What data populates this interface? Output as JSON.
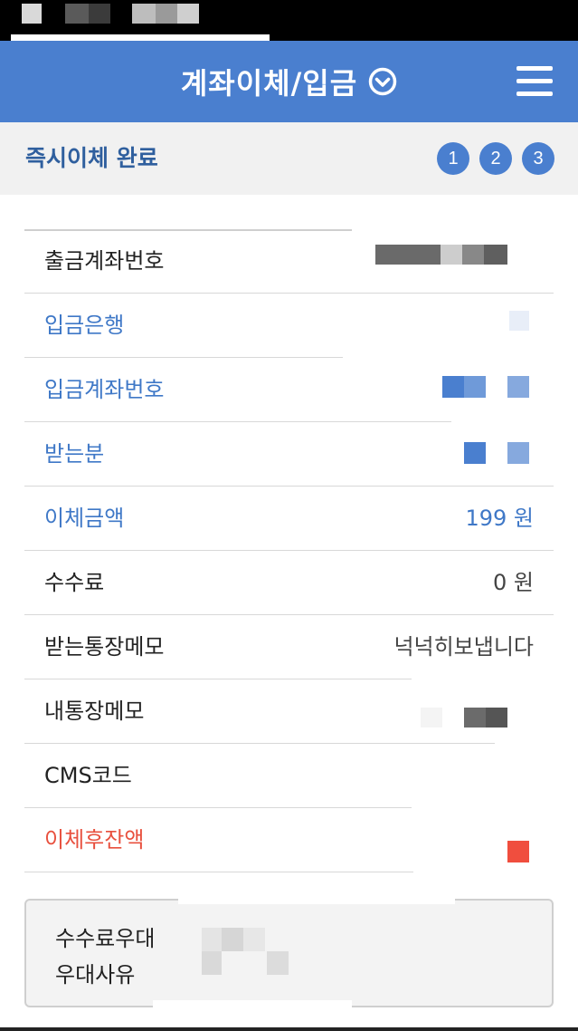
{
  "header": {
    "title": "계좌이체/입금",
    "dropdown_icon": "chevron-down-circle-icon",
    "menu_icon": "hamburger-menu-icon",
    "color": "#4a7fcf"
  },
  "subheader": {
    "title": "즉시이체 완료",
    "steps": [
      "1",
      "2",
      "3"
    ]
  },
  "details": {
    "rows": [
      {
        "label": "출금계좌번호",
        "value": ""
      },
      {
        "label": "입금은행",
        "value": ""
      },
      {
        "label": "입금계좌번호",
        "value": ""
      },
      {
        "label": "받는분",
        "value": ""
      },
      {
        "label": "이체금액",
        "value": "199 원"
      },
      {
        "label": "수수료",
        "value": "0 원"
      },
      {
        "label": "받는통장메모",
        "value": "넉넉히보냅니다"
      },
      {
        "label": "내통장메모",
        "value": ""
      },
      {
        "label": "CMS코드",
        "value": ""
      },
      {
        "label": "이체후잔액",
        "value": ""
      }
    ],
    "label_color_blue": "#3f78c7",
    "label_color_red": "#e8503e"
  },
  "fee_box": {
    "line1": "수수료우대",
    "line2": "우대사유"
  }
}
